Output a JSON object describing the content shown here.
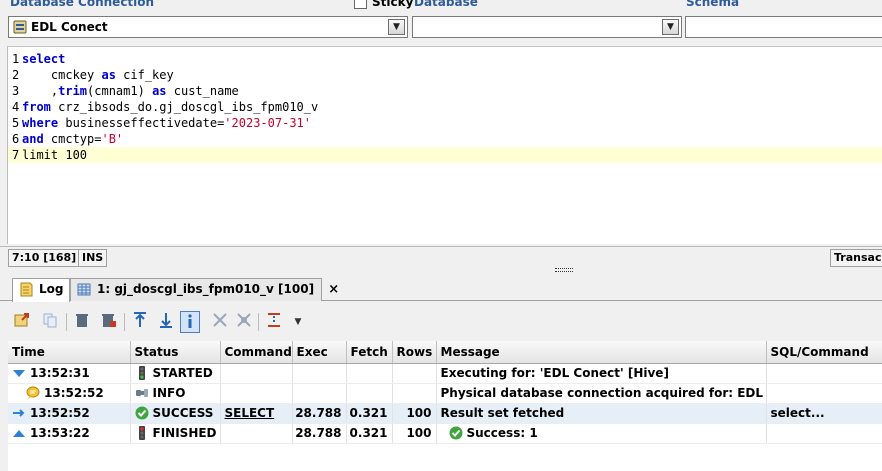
{
  "header": {
    "connection_label": "Database Connection",
    "sticky_label": "Sticky",
    "database_label": "Database",
    "schema_label": "Schema",
    "connection_value": "EDL Conect",
    "database_value": "",
    "schema_value": ""
  },
  "editor": {
    "lines": [
      {
        "num": "1",
        "parts": [
          {
            "t": "select",
            "c": "kw"
          }
        ]
      },
      {
        "num": "2",
        "parts": [
          {
            "t": "    cmckey ",
            "c": ""
          },
          {
            "t": "as",
            "c": "kw"
          },
          {
            "t": " cif_key",
            "c": ""
          }
        ]
      },
      {
        "num": "3",
        "parts": [
          {
            "t": "    ,",
            "c": ""
          },
          {
            "t": "trim",
            "c": "kw"
          },
          {
            "t": "(cmnam1) ",
            "c": ""
          },
          {
            "t": "as",
            "c": "kw"
          },
          {
            "t": " cust_name",
            "c": ""
          }
        ]
      },
      {
        "num": "4",
        "parts": [
          {
            "t": "from",
            "c": "kw"
          },
          {
            "t": " crz_ibsods_do.gj_doscgl_ibs_fpm010_v",
            "c": ""
          }
        ]
      },
      {
        "num": "5",
        "parts": [
          {
            "t": "where",
            "c": "kw"
          },
          {
            "t": " businesseffectivedate=",
            "c": ""
          },
          {
            "t": "'2023-07-31'",
            "c": "str"
          }
        ]
      },
      {
        "num": "6",
        "parts": [
          {
            "t": "and",
            "c": "kw"
          },
          {
            "t": " cmctyp=",
            "c": ""
          },
          {
            "t": "'B'",
            "c": "str"
          }
        ]
      },
      {
        "num": "7",
        "parts": [
          {
            "t": "limit 100",
            "c": ""
          }
        ]
      }
    ]
  },
  "status": {
    "position": "7:10 [168]",
    "mode": "INS",
    "transaction": "Transac"
  },
  "tabs": [
    {
      "label": "Log",
      "icon": "log-icon",
      "active": true
    },
    {
      "label": "1: gj_doscgl_ibs_fpm010_v [100]",
      "icon": "grid-icon",
      "active": false,
      "close": "×"
    }
  ],
  "log": {
    "columns": [
      "Time",
      "Status",
      "Command",
      "Exec",
      "Fetch",
      "Rows",
      "Message",
      "SQL/Command"
    ],
    "rows": [
      {
        "time": "13:52:31",
        "time_icon": "expand-down-icon",
        "status": "STARTED",
        "status_icon": "traffic-light-green-icon",
        "command": "",
        "exec": "",
        "fetch": "",
        "rows": "",
        "message": "Executing for: 'EDL Conect' [Hive]",
        "sql": ""
      },
      {
        "time": "13:52:52",
        "time_icon": "chat-bubble-icon",
        "status": "INFO",
        "status_icon": "plug-icon",
        "command": "",
        "exec": "",
        "fetch": "",
        "rows": "",
        "message": "Physical database connection acquired for: EDL Conect",
        "sql": ""
      },
      {
        "time": "13:52:52",
        "time_icon": "arrow-right-icon",
        "status": "SUCCESS",
        "status_icon": "check-circle-icon",
        "command": "SELECT",
        "exec": "28.788",
        "fetch": "0.321",
        "rows": "100",
        "message": "Result set fetched",
        "sql": "select..."
      },
      {
        "time": "13:53:22",
        "time_icon": "collapse-up-icon",
        "status": "FINISHED",
        "status_icon": "traffic-light-red-icon",
        "command": "",
        "exec": "28.788",
        "fetch": "0.321",
        "rows": "100",
        "message": "Success: 1",
        "sql": ""
      }
    ]
  }
}
